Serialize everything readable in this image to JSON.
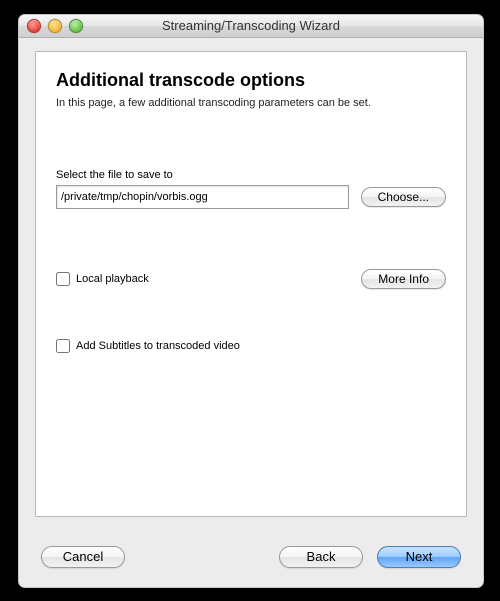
{
  "window": {
    "title": "Streaming/Transcoding Wizard"
  },
  "page": {
    "heading": "Additional transcode options",
    "subtext": "In this page, a few additional transcoding parameters can be set."
  },
  "file": {
    "label": "Select the file to save to",
    "path": "/private/tmp/chopin/vorbis.ogg",
    "choose_label": "Choose..."
  },
  "options": {
    "local_playback_label": "Local playback",
    "local_playback_checked": false,
    "more_info_label": "More Info",
    "add_subtitles_label": "Add Subtitles to transcoded video",
    "add_subtitles_checked": false
  },
  "footer": {
    "cancel": "Cancel",
    "back": "Back",
    "next": "Next"
  }
}
